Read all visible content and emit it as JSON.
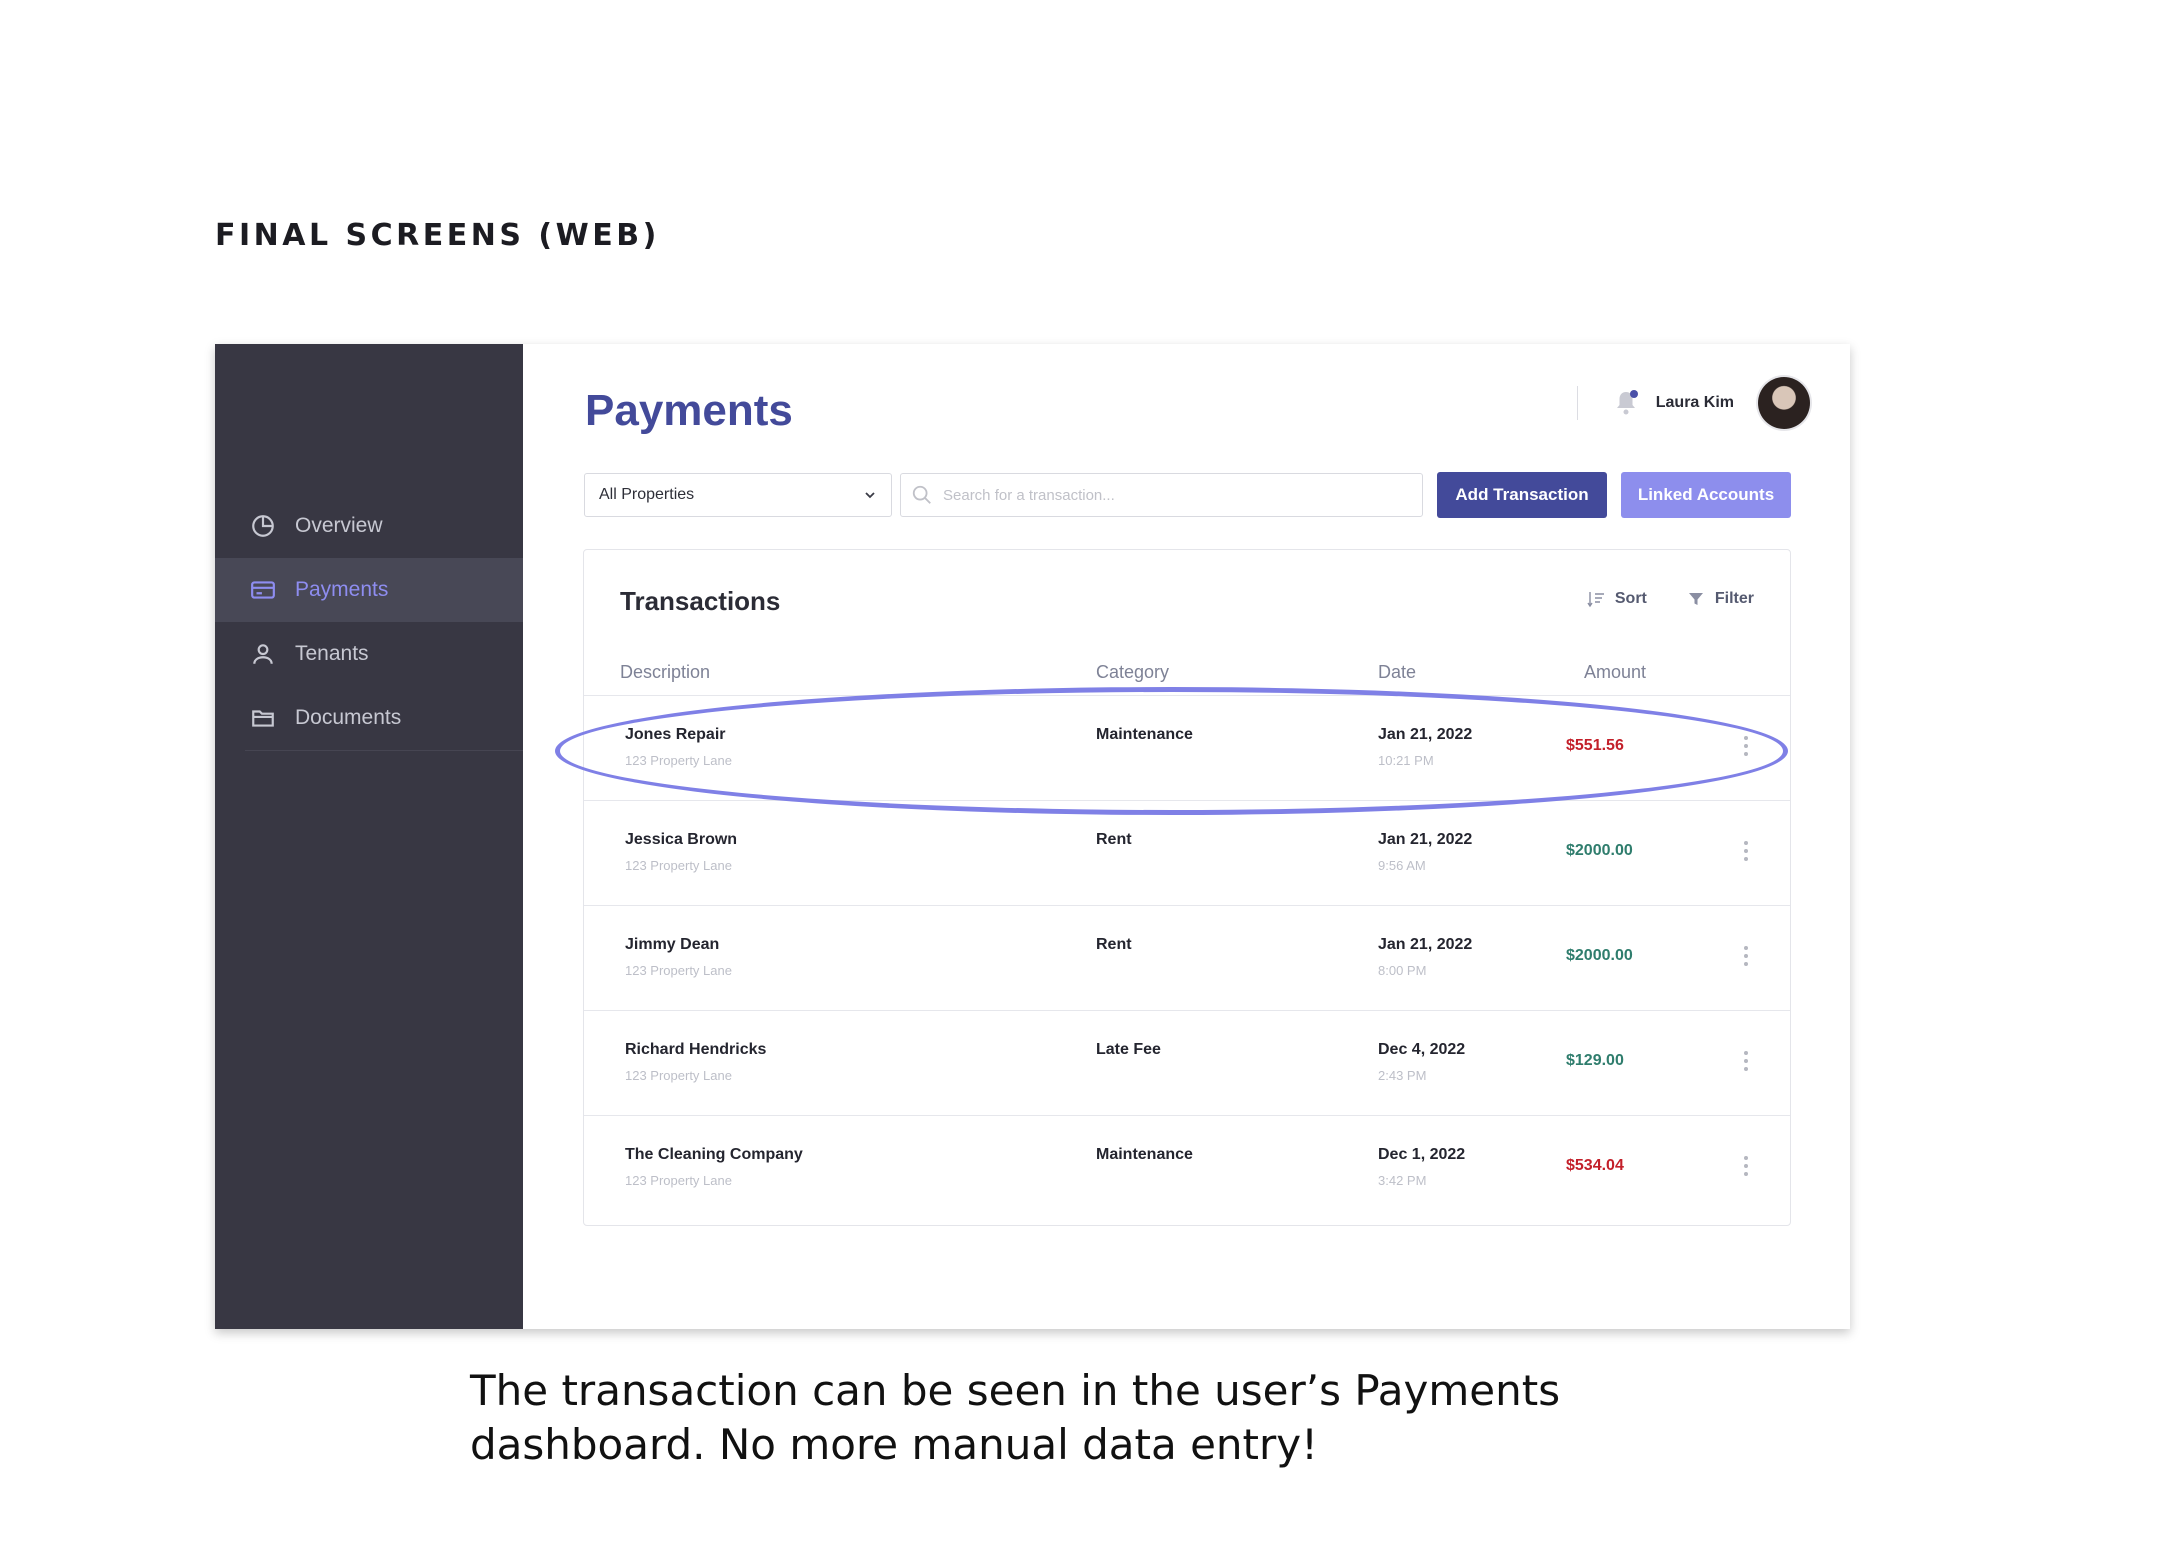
{
  "heading": "FINAL SCREENS (WEB)",
  "sidebar": {
    "items": [
      {
        "label": "Overview",
        "icon": "pie-chart-icon",
        "active": false
      },
      {
        "label": "Payments",
        "icon": "credit-card-icon",
        "active": true
      },
      {
        "label": "Tenants",
        "icon": "user-icon",
        "active": false
      },
      {
        "label": "Documents",
        "icon": "folder-icon",
        "active": false
      }
    ]
  },
  "header": {
    "title": "Payments",
    "user_name": "Laura Kim"
  },
  "toolbar": {
    "property_select": "All Properties",
    "search_placeholder": "Search for a transaction...",
    "add_label": "Add Transaction",
    "linked_label": "Linked Accounts"
  },
  "transactions": {
    "title": "Transactions",
    "sort_label": "Sort",
    "filter_label": "Filter",
    "columns": [
      "Description",
      "Category",
      "Date",
      "Amount"
    ],
    "rows": [
      {
        "name": "Jones Repair",
        "address": "123 Property Lane",
        "category": "Maintenance",
        "date": "Jan 21, 2022",
        "time": "10:21 PM",
        "amount": "$551.56",
        "type": "expense"
      },
      {
        "name": "Jessica Brown",
        "address": "123 Property Lane",
        "category": "Rent",
        "date": "Jan 21, 2022",
        "time": "9:56 AM",
        "amount": "$2000.00",
        "type": "income"
      },
      {
        "name": "Jimmy Dean",
        "address": "123 Property Lane",
        "category": "Rent",
        "date": "Jan 21, 2022",
        "time": "8:00 PM",
        "amount": "$2000.00",
        "type": "income"
      },
      {
        "name": "Richard Hendricks",
        "address": "123 Property Lane",
        "category": "Late Fee",
        "date": "Dec 4, 2022",
        "time": "2:43 PM",
        "amount": "$129.00",
        "type": "income"
      },
      {
        "name": "The Cleaning Company",
        "address": "123 Property Lane",
        "category": "Maintenance",
        "date": "Dec 1, 2022",
        "time": "3:42 PM",
        "amount": "$534.04",
        "type": "expense"
      }
    ]
  },
  "caption": {
    "line1": "The transaction can be seen in the user’s Payments",
    "line2": "dashboard. No more manual data entry!"
  },
  "colors": {
    "accent": "#434a9a",
    "accent_light": "#8d8eed",
    "sidebar_bg": "#383743",
    "expense": "#c3202a",
    "income": "#2f7d6d",
    "highlight": "#7f80e6"
  }
}
